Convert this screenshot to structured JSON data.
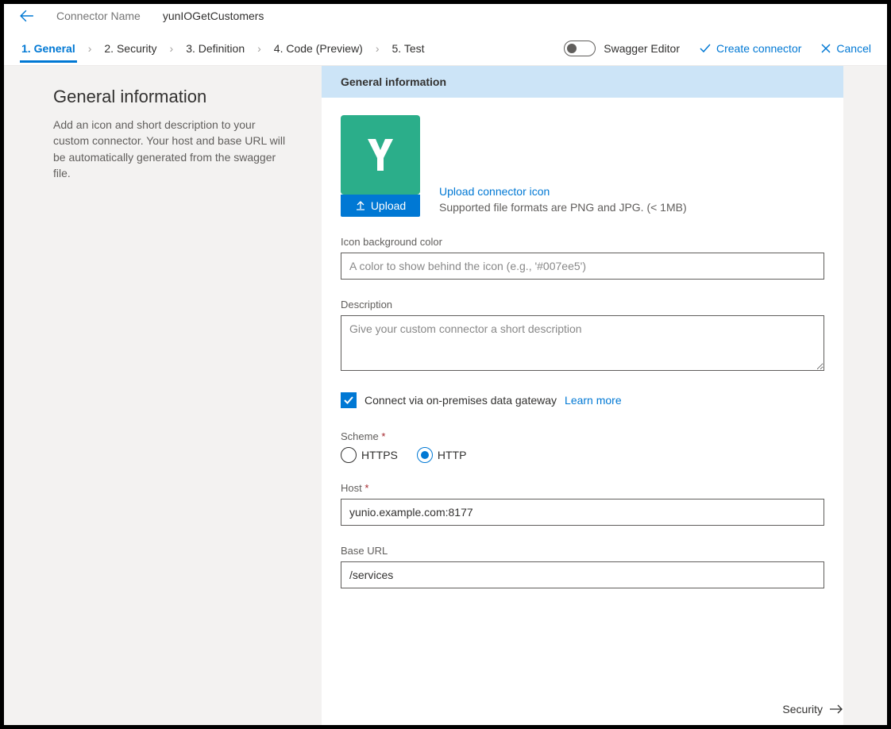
{
  "header": {
    "connector_label": "Connector Name",
    "connector_name": "yunIOGetCustomers"
  },
  "tabs": {
    "items": [
      "1. General",
      "2. Security",
      "3. Definition",
      "4. Code (Preview)",
      "5. Test"
    ],
    "active_index": 0
  },
  "actions": {
    "swagger": "Swagger Editor",
    "create": "Create connector",
    "cancel": "Cancel"
  },
  "sidebar": {
    "title": "General information",
    "desc": "Add an icon and short description to your custom connector. Your host and base URL will be automatically generated from the swagger file."
  },
  "panel": {
    "header": "General information",
    "upload_label": "Upload",
    "upload_link": "Upload connector icon",
    "supported": "Supported file formats are PNG and JPG. (< 1MB)",
    "fields": {
      "icon_bg": {
        "label": "Icon background color",
        "placeholder": "A color to show behind the icon (e.g., '#007ee5')",
        "value": ""
      },
      "description": {
        "label": "Description",
        "placeholder": "Give your custom connector a short description",
        "value": ""
      },
      "gateway": {
        "label": "Connect via on-premises data gateway",
        "learn": "Learn more",
        "checked": true
      },
      "scheme": {
        "label": "Scheme",
        "options": [
          "HTTPS",
          "HTTP"
        ],
        "selected": "HTTP"
      },
      "host": {
        "label": "Host",
        "value": "yunio.example.com:8177"
      },
      "base_url": {
        "label": "Base URL",
        "value": "/services"
      }
    }
  },
  "footer": {
    "next": "Security"
  }
}
